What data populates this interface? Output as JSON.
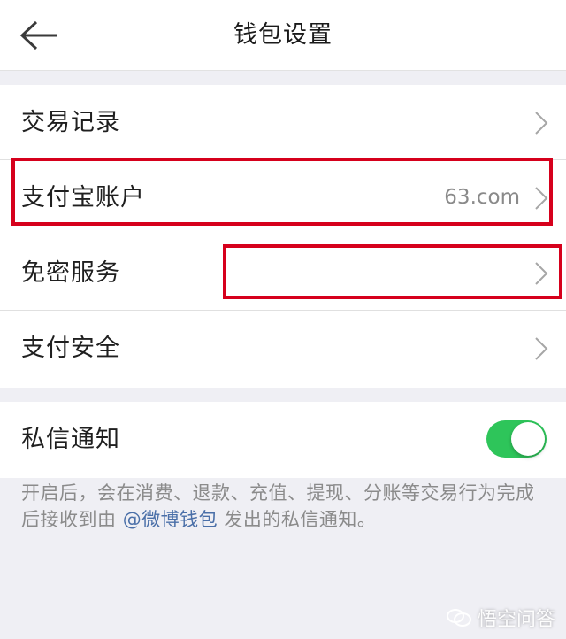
{
  "header": {
    "title": "钱包设置",
    "back_icon": "arrow-left-icon"
  },
  "settings_group": {
    "items": [
      {
        "label": "交易记录",
        "value": ""
      },
      {
        "label": "支付宝账户",
        "value": "63.com"
      },
      {
        "label": "免密服务",
        "value": ""
      },
      {
        "label": "支付安全",
        "value": ""
      }
    ]
  },
  "notification": {
    "label": "私信通知",
    "enabled": true,
    "description_before": "开启后，会在消费、退款、充值、提现、分账等交易行为完成后接收到由 ",
    "description_link": "@微博钱包",
    "description_after": " 发出的私信通知。"
  },
  "watermark": {
    "text": "悟空问答",
    "icon": "chat-bubbles-icon"
  },
  "colors": {
    "toggle_on": "#2ec55a",
    "highlight_border": "#d6001c",
    "link": "#4a6fa8",
    "background": "#efeff4"
  }
}
